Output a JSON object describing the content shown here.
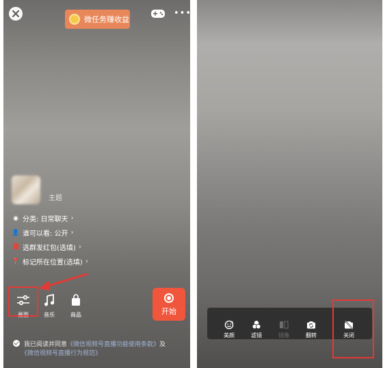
{
  "left": {
    "task_button": "微任务赚收益",
    "topic": "主题",
    "info_items": [
      {
        "icon": "category-icon",
        "label": "分类: 日常聊天"
      },
      {
        "icon": "visibility-icon",
        "label": "谁可以看: 公开"
      },
      {
        "icon": "red-packet-icon",
        "label": "选群发红包(选填)"
      },
      {
        "icon": "location-icon",
        "label": "标记所在位置(选填)"
      }
    ],
    "tools": [
      {
        "icon": "picture-settings-icon",
        "label": "画面"
      },
      {
        "icon": "music-icon",
        "label": "音乐"
      },
      {
        "icon": "shopping-bag-icon",
        "label": "商品"
      }
    ],
    "start_label": "开始",
    "agree": {
      "prefix": "我已阅读并同意",
      "link1": "《微信视频号直播功能使用条款》",
      "joiner": "及",
      "link2": "《微信视频号直播行为规范》"
    }
  },
  "right": {
    "tools": [
      {
        "icon": "beauty-icon",
        "label": "美颜"
      },
      {
        "icon": "filter-icon",
        "label": "滤镜"
      },
      {
        "icon": "mirror-icon",
        "label": "镜像"
      },
      {
        "icon": "flip-camera-icon",
        "label": "翻转"
      },
      {
        "icon": "camera-off-icon",
        "label": "关闭"
      }
    ]
  },
  "colors": {
    "start_button": "#f0563c",
    "task_button": "#e8875a",
    "highlight": "#e53935",
    "link": "#9fb3d6"
  }
}
